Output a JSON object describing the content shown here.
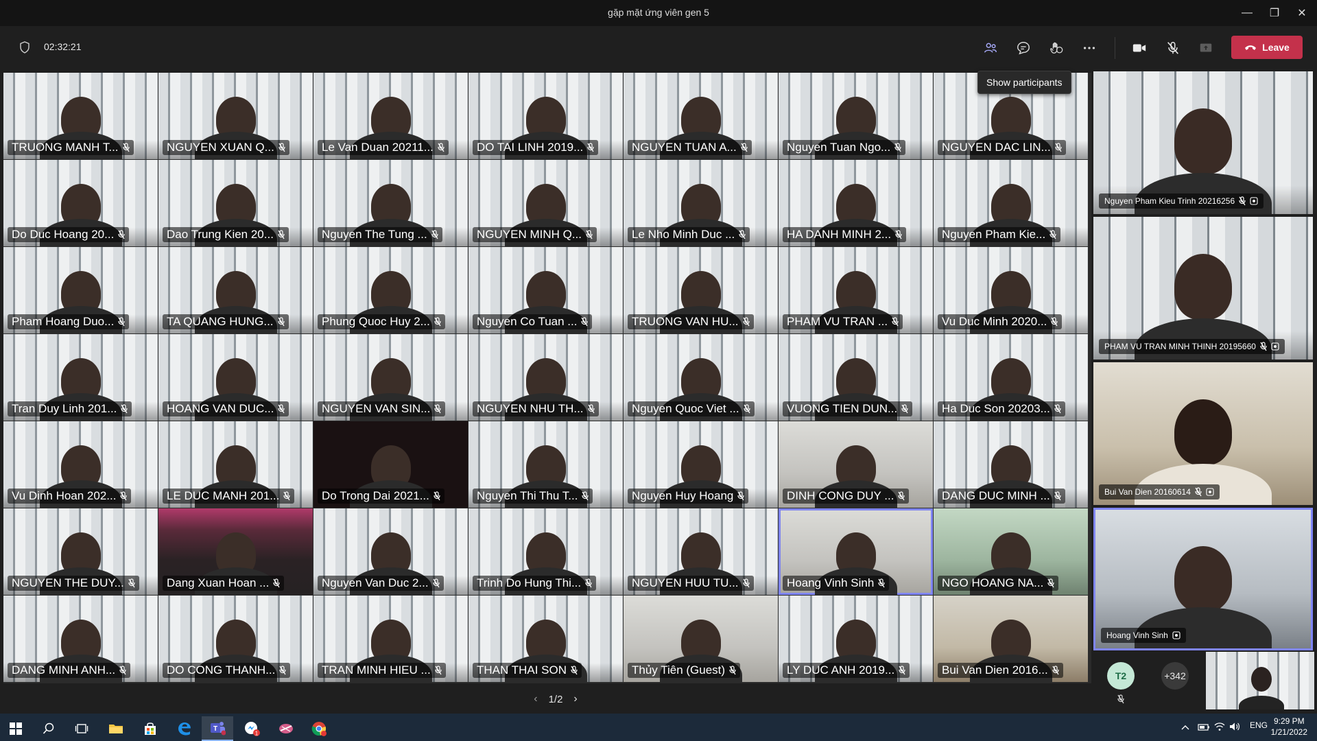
{
  "window": {
    "title": "gặp mặt ứng viên gen 5",
    "minimize_label": "—",
    "restore_label": "❐",
    "close_label": "✕"
  },
  "toolbar": {
    "timer": "02:32:21",
    "leave_label": "Leave",
    "tooltip": "Show participants"
  },
  "gallery": {
    "rows": [
      [
        "TRUONG MANH T...",
        "NGUYEN XUAN Q...",
        "Le Van Duan 20211...",
        "DO TAI LINH 2019...",
        "NGUYEN TUAN A...",
        "Nguyen Tuan Ngo...",
        "NGUYEN DAC LIN..."
      ],
      [
        "Do Duc Hoang 20...",
        "Dao Trung Kien 20...",
        "Nguyen The Tung ...",
        "NGUYEN MINH Q...",
        "Le Nho Minh Duc ...",
        "HA DANH MINH 2...",
        "Nguyen Pham Kie..."
      ],
      [
        "Pham Hoang Duo...",
        "TA QUANG HUNG...",
        "Phung Quoc Huy 2...",
        "Nguyen Co Tuan ...",
        "TRUONG VAN HU...",
        "PHAM VU TRAN ...",
        "Vu Duc Minh 2020..."
      ],
      [
        "Tran Duy Linh 201...",
        "HOANG VAN DUC...",
        "NGUYEN VAN SIN...",
        "NGUYEN NHU TH...",
        "Nguyen Quoc Viet ...",
        "VUONG TIEN DUN...",
        "Ha Duc Son 20203..."
      ],
      [
        "Vu Dinh Hoan 202...",
        "LE DUC MANH 201...",
        "Do Trong Dai 2021...",
        "Nguyen Thi Thu T...",
        "Nguyen Huy Hoang",
        "DINH CONG DUY ...",
        "DANG DUC MINH ..."
      ],
      [
        "NGUYEN THE DUY...",
        "Dang Xuan Hoan ...",
        "Nguyen Van Duc 2...",
        "Trinh Do Hung Thi...",
        "NGUYEN HUU TU...",
        "Hoang Vinh Sinh",
        "NGO HOANG NA..."
      ],
      [
        "DANG MINH ANH...",
        "DO CONG THANH...",
        "TRAN MINH HIEU ...",
        "THAN THAI SON",
        "Thủy Tiên (Guest)",
        "LY DUC ANH 2019...",
        "Bui Van Dien 2016..."
      ]
    ]
  },
  "side": {
    "tiles": [
      {
        "name": "Nguyen Pham Kieu Trinh 20216256"
      },
      {
        "name": "PHAM VU TRAN MINH THINH 20195660"
      },
      {
        "name": "Bui Van Dien 20160614"
      },
      {
        "name": "Hoang Vinh Sinh"
      }
    ],
    "avatar_initials": "T2",
    "overflow_count": "+342"
  },
  "pager": {
    "label": "1/2",
    "prev": "‹",
    "next": "›"
  },
  "taskbar": {
    "lang": "ENG",
    "time": "9:29 PM",
    "date": "1/21/2022",
    "chrome_badge": "1"
  },
  "colors": {
    "leave": "#c4314b",
    "accent": "#7f85f5",
    "taskbar": "#1c2a3a"
  }
}
